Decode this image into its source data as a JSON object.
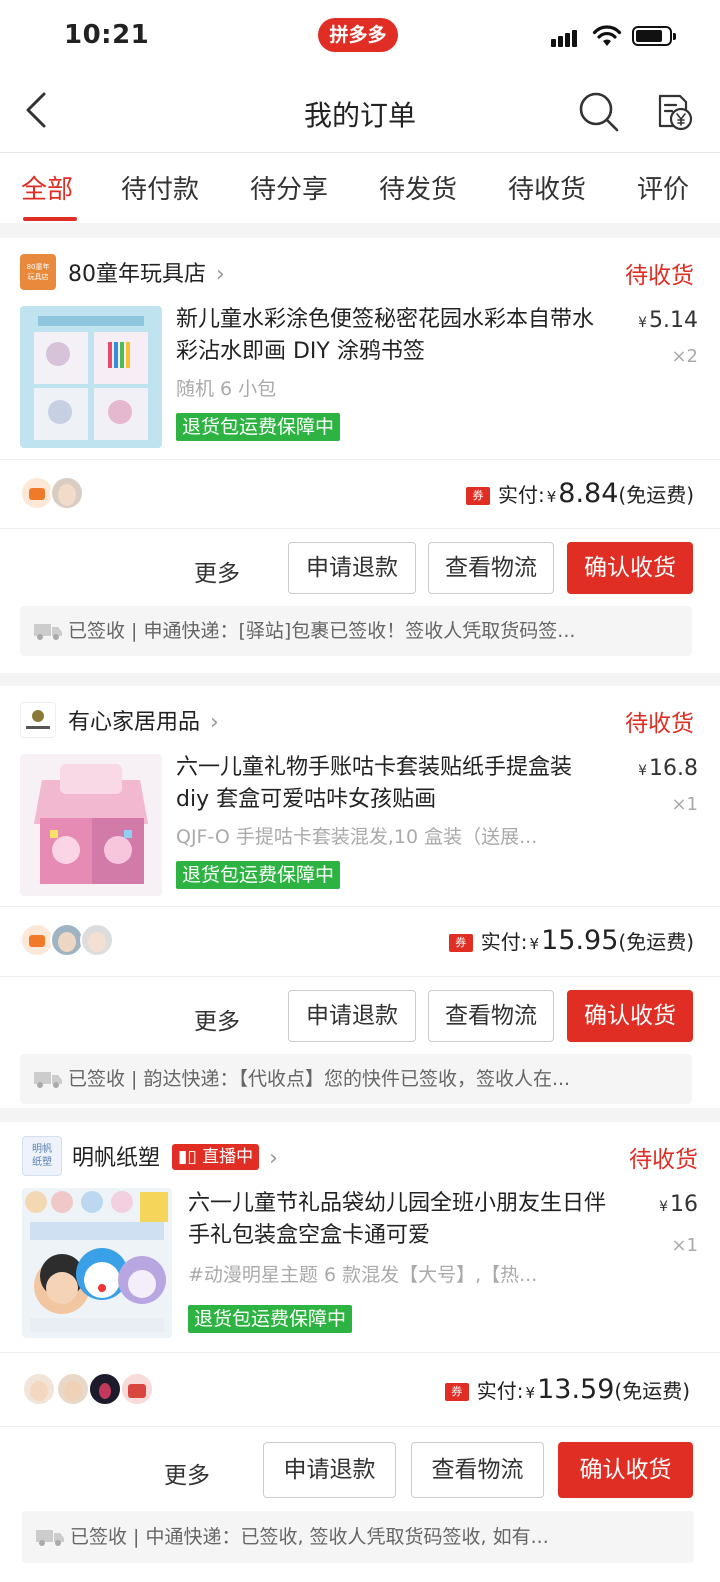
{
  "status_bar": {
    "time": "10:21",
    "app_badge": "拼多多"
  },
  "nav": {
    "title": "我的订单"
  },
  "tabs": [
    "全部",
    "待付款",
    "待分享",
    "待发货",
    "待收货",
    "评价"
  ],
  "orders": [
    {
      "shop_name": "80童年玩具店",
      "shop_logo_text": "80童年\n玩具店",
      "status": "待收货",
      "product_title": "新儿童水彩涂色便签秘密花园水彩本自带水彩沾水即画 DIY 涂鸦书签",
      "spec": "随机 6 小包",
      "guarantee": "退货包运费保障中",
      "price_symbol": "¥",
      "price": "5.14",
      "qty": "×2",
      "paid_label": "实付:",
      "paid_symbol": "¥",
      "paid_amount": "8.84",
      "shipping_note": "(免运费)",
      "coupon": "券",
      "more": "更多",
      "btn_refund": "申请退款",
      "btn_logistics": "查看物流",
      "btn_confirm": "确认收货",
      "logistics": "已签收 | 申通快递：[驿站]包裹已签收！签收人凭取货码签..."
    },
    {
      "shop_name": "有心家居用品",
      "status": "待收货",
      "product_title": "六一儿童礼物手账咕卡套装贴纸手提盒装 diy 套盒可爱咕咔女孩贴画",
      "spec": "QJF-O 手提咕卡套装混发,10 盒装（送展...",
      "guarantee": "退货包运费保障中",
      "price_symbol": "¥",
      "price": "16.8",
      "qty": "×1",
      "paid_label": "实付:",
      "paid_symbol": "¥",
      "paid_amount": "15.95",
      "shipping_note": "(免运费)",
      "coupon": "券",
      "more": "更多",
      "btn_refund": "申请退款",
      "btn_logistics": "查看物流",
      "btn_confirm": "确认收货",
      "logistics": "已签收 | 韵达快递：【代收点】您的快件已签收，签收人在..."
    },
    {
      "shop_name": "明帆纸塑",
      "shop_logo_text": "明帆\n纸塑",
      "live_badge": "直播中",
      "status": "待收货",
      "product_title": "六一儿童节礼品袋幼儿园全班小朋友生日伴手礼包装盒空盒卡通可爱",
      "spec": "#动漫明星主题 6 款混发【大号】,【热...",
      "guarantee": "退货包运费保障中",
      "price_symbol": "¥",
      "price": "16",
      "qty": "×1",
      "paid_label": "实付:",
      "paid_symbol": "¥",
      "paid_amount": "13.59",
      "shipping_note": "(免运费)",
      "coupon": "券",
      "more": "更多",
      "btn_refund": "申请退款",
      "btn_logistics": "查看物流",
      "btn_confirm": "确认收货",
      "logistics": "已签收 | 中通快递：已签收, 签收人凭取货码签收, 如有..."
    }
  ],
  "colors": {
    "brand_red": "#e02e24",
    "guarantee_green": "#2db341"
  },
  "icons": [
    "back-icon",
    "search-icon",
    "bill-icon",
    "truck-icon",
    "chevron-right-icon",
    "signal-icon",
    "wifi-icon",
    "battery-icon"
  ]
}
